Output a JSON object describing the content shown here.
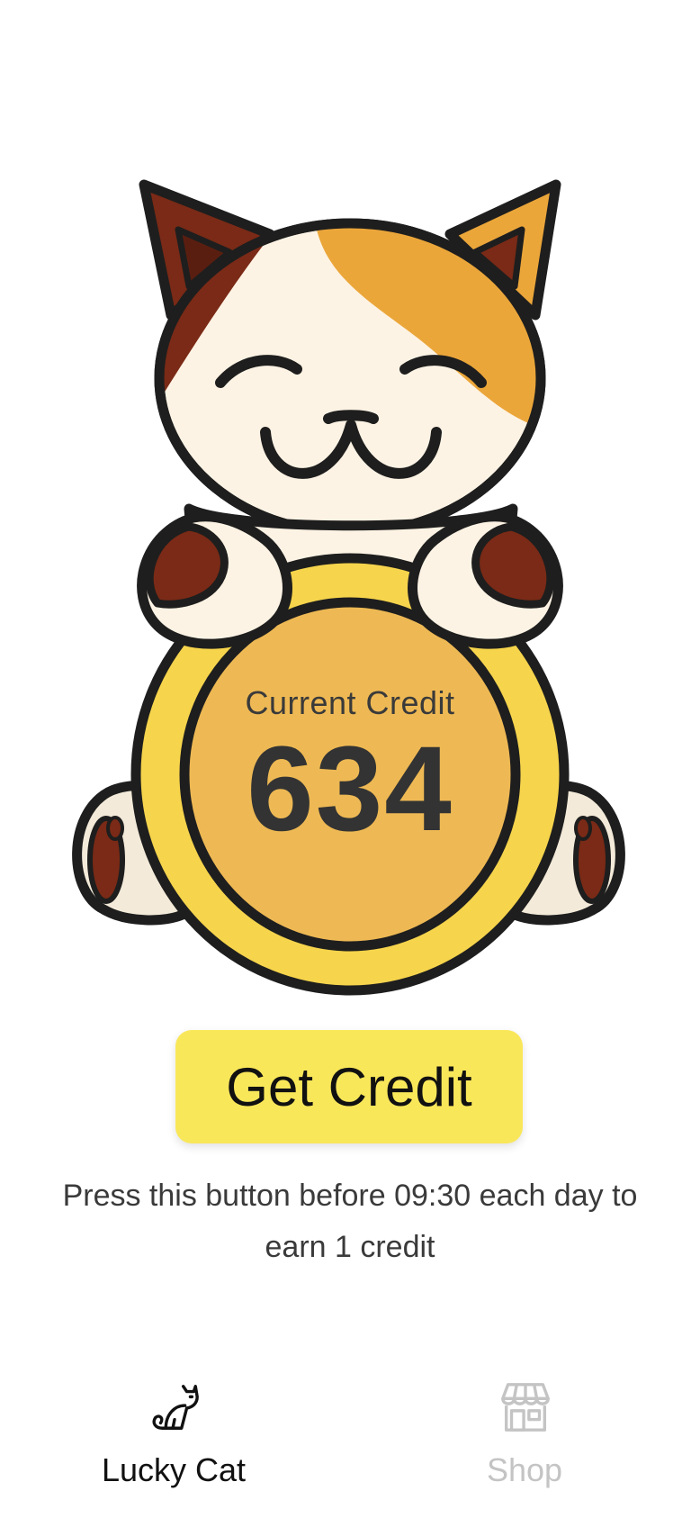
{
  "credit": {
    "label": "Current Credit",
    "value": "634"
  },
  "action": {
    "button_label": "Get Credit",
    "hint": "Press this button before 09:30 each day to earn 1 credit"
  },
  "tabs": [
    {
      "label": "Lucky Cat",
      "icon": "cat-icon",
      "active": true
    },
    {
      "label": "Shop",
      "icon": "store-icon",
      "active": false
    }
  ],
  "colors": {
    "button": "#f9e75a",
    "coin_outer": "#f6d44c",
    "coin_inner": "#eeb954",
    "cat_body": "#fdf3e4",
    "cat_orange": "#eba63a",
    "cat_brown": "#7a2a16",
    "outline": "#1e1e1e",
    "tab_active": "#111111",
    "tab_inactive": "#c4c4c4"
  }
}
